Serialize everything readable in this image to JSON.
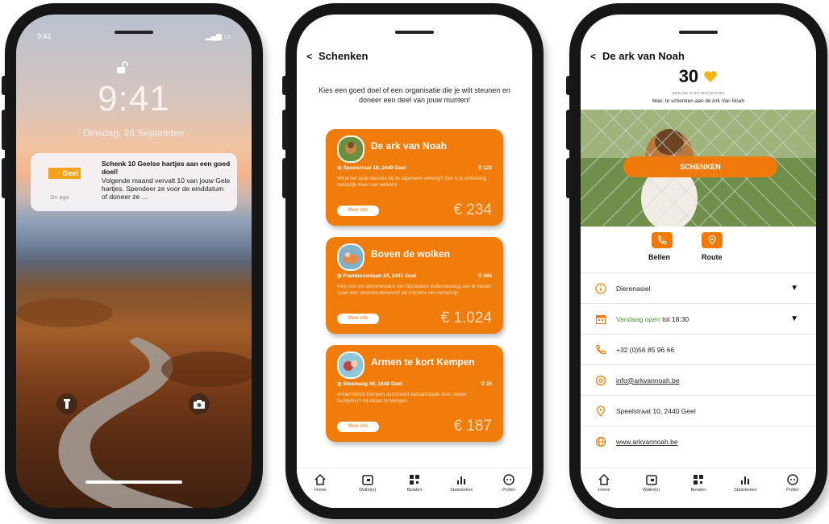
{
  "lockscreen": {
    "status_time": "9:41",
    "time": "9:41",
    "date": "Dinsdag, 26 September",
    "notification": {
      "app": "Geel",
      "ago": "2m ago",
      "title": "Schenk 10 Geelse hartjes aan een goed doel!",
      "body": "Volgende maand vervalt 10 van jouw Gele hartjes. Spendeer ze voor de einddatum of doneer ze ..."
    }
  },
  "donate": {
    "header": "Schenken",
    "intro": "Kies een goed doel of een organisatie die je wilt steunen en doneer een deel van jouw munten!",
    "more_label": "Meer info",
    "cards": [
      {
        "name": "De ark van Noah",
        "address": "Speelstraat 10, 2440 Geel",
        "count": "123",
        "description": "Wil je het asiel steunen bij de algemene werking? Dan is je schenking natuurlijk meer dan welkom!",
        "amount": "€ 234"
      },
      {
        "name": "Boven de wolken",
        "address": "Frambozenlaan 24, 2440 Geel",
        "count": "485",
        "description": "Help ons om sterrenouders een bijzondere ondersteuning aan te bieden zoals een sterrenouderavond als moment van samenzijn",
        "amount": "€ 1.024"
      },
      {
        "name": "Armen te kort Kempen",
        "address": "Steenweg 40, 2440 Geel",
        "count": "25",
        "description": "ArmenTeKort Kempen doorbreekt kansarmoede door unieke buddyduo's bij elkaar te brengen.",
        "amount": "€ 187"
      }
    ]
  },
  "detail": {
    "header": "De ark van Noah",
    "hearts": "30",
    "hearts_caption": "GEELSE HARTJES(30 EUR)",
    "max_text": "Max. te schenken aan de Ark Van Noah",
    "donate_button": "SCHENKEN",
    "call_label": "Bellen",
    "route_label": "Route",
    "category": "Dierenasiel",
    "open_status": "Vandaag open",
    "open_until": "tot 18:30",
    "phone": "+32 (0)56 85 96 66",
    "email": "info@arkvannoah.be",
    "address": "Speelstraat 10, 2440 Geel",
    "website": "www.arkvannoah.be"
  },
  "tabbar": [
    "Home",
    "Wallet(s)",
    "Betalen",
    "Statistieken",
    "Profiel"
  ],
  "colors": {
    "accent": "#f07d0b",
    "heart": "#f4b41a",
    "open_green": "#4a9a3d"
  }
}
